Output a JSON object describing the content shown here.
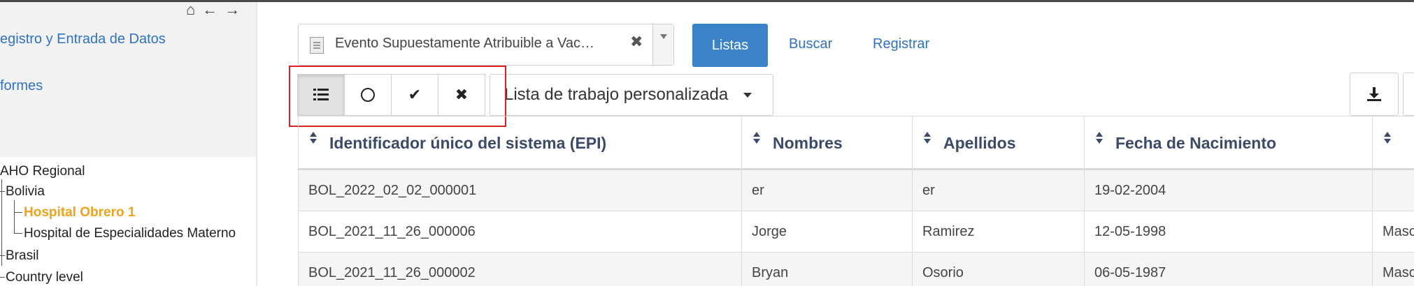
{
  "sidebar": {
    "nav_icons": [
      "home-icon",
      "arrow-left-icon",
      "arrow-right-icon"
    ],
    "menu": [
      {
        "label": "egistro y Entrada de Datos"
      },
      {
        "label": "formes"
      }
    ],
    "tree": [
      {
        "label": "AHO Regional"
      },
      {
        "label": "Bolivia"
      },
      {
        "label": "Hospital Obrero 1",
        "selected": true
      },
      {
        "label": "Hospital de Especialidades Materno"
      },
      {
        "label": "Brasil"
      },
      {
        "label": "Country level"
      }
    ]
  },
  "header": {
    "select_value": "Evento Supuestamente Atribuible a Vac…",
    "clear_symbol": "✖",
    "buttons": {
      "listas": "Listas",
      "buscar": "Buscar",
      "registrar": "Registrar"
    }
  },
  "toolbar": {
    "check_symbol": "✔",
    "cross_symbol": "✖",
    "worklist_label": "Lista de trabajo personalizada"
  },
  "table": {
    "columns": [
      "Identificador único del sistema (EPI)",
      "Nombres",
      "Apellidos",
      "Fecha de Nacimiento",
      ""
    ],
    "rows": [
      [
        "BOL_2022_02_02_000001",
        "er",
        "er",
        "19-02-2004",
        ""
      ],
      [
        "BOL_2021_11_26_000006",
        "Jorge",
        "Ramirez",
        "12-05-1998",
        "Masc"
      ],
      [
        "BOL_2021_11_26_000002",
        "Bryan",
        "Osorio",
        "06-05-1987",
        "Masc"
      ]
    ]
  },
  "colors": {
    "primary": "#3a83c9",
    "link": "#2f72c4",
    "selected_tree": "#f0a21b",
    "highlight": "#e02020"
  }
}
